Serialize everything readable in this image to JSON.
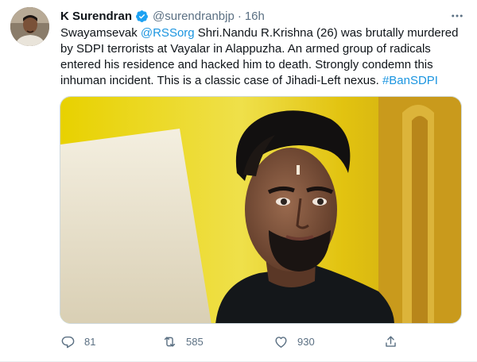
{
  "tweet": {
    "author_name": "K Surendran",
    "handle": "@surendranbjp",
    "separator": "·",
    "time": "16h",
    "text_parts": {
      "p1": "Swayamsevak ",
      "mention": "@RSSorg",
      "p2": " Shri.Nandu R.Krishna (26) was brutally murdered by SDPI terrorists at Vayalar in Alappuzha. An armed group of radicals entered his residence and hacked him to death. Strongly condemn this inhuman incident. This is a classic case of Jihadi-Left nexus. ",
      "hashtag": "#BanSDPI"
    },
    "stats": {
      "replies": "81",
      "retweets": "585",
      "likes": "930"
    }
  },
  "icons": {
    "verified": "verified-badge-icon",
    "more": "more-icon",
    "reply": "reply-icon",
    "retweet": "retweet-icon",
    "like": "heart-icon",
    "share": "share-icon"
  },
  "colors": {
    "accent": "#1da1f2",
    "link": "#1b95e0",
    "secondary_text": "#5b7083"
  }
}
